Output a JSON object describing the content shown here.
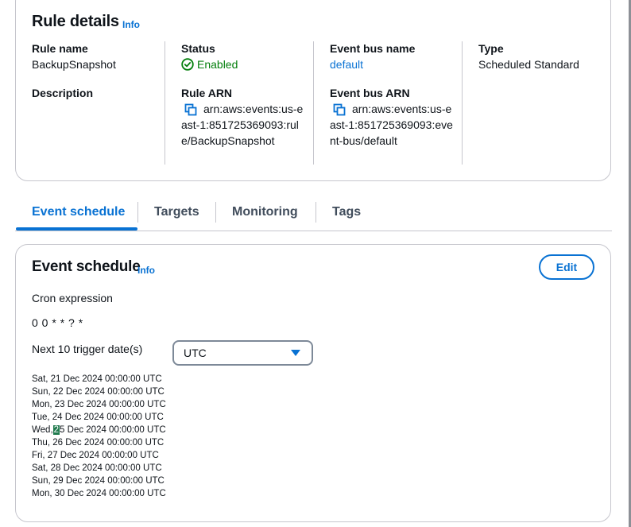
{
  "rule_details": {
    "title": "Rule details",
    "info": "Info",
    "rule_name_label": "Rule name",
    "rule_name_value": "BackupSnapshot",
    "description_label": "Description",
    "status_label": "Status",
    "status_value": "Enabled",
    "rule_arn_label": "Rule ARN",
    "rule_arn_value": "arn:aws:events:us-east-1:851725369093:rule/BackupSnapshot",
    "event_bus_name_label": "Event bus name",
    "event_bus_name_value": "default",
    "event_bus_arn_label": "Event bus ARN",
    "event_bus_arn_value": "arn:aws:events:us-east-1:851725369093:event-bus/default",
    "type_label": "Type",
    "type_value": "Scheduled Standard"
  },
  "tabs": [
    {
      "label": "Event schedule",
      "active": true
    },
    {
      "label": "Targets"
    },
    {
      "label": "Monitoring"
    },
    {
      "label": "Tags"
    }
  ],
  "event_schedule": {
    "title": "Event schedule",
    "info": "Info",
    "edit_label": "Edit",
    "cron_label": "Cron expression",
    "cron_value": "0 0 * * ? *",
    "next_label": "Next 10 trigger date(s)",
    "timezone_value": "UTC",
    "dates": [
      "Sat, 21 Dec 2024 00:00:00 UTC",
      "Sun, 22 Dec 2024 00:00:00 UTC",
      "Mon, 23 Dec 2024 00:00:00 UTC",
      "Tue, 24 Dec 2024 00:00:00 UTC",
      "5 Dec 2024 00:00:00 UTC",
      "Thu, 26 Dec 2024 00:00:00 UTC",
      "Fri, 27 Dec 2024 00:00:00 UTC",
      "Sat, 28 Dec 2024 00:00:00 UTC",
      "Sun, 29 Dec 2024 00:00:00 UTC",
      "Mon, 30 Dec 2024 00:00:00 UTC"
    ],
    "highlight_prefix": "Wed,",
    "highlight_char": "2"
  },
  "colors": {
    "link": "#0972d3",
    "success": "#037f0c",
    "selection_highlight": "#1f7a4d"
  }
}
